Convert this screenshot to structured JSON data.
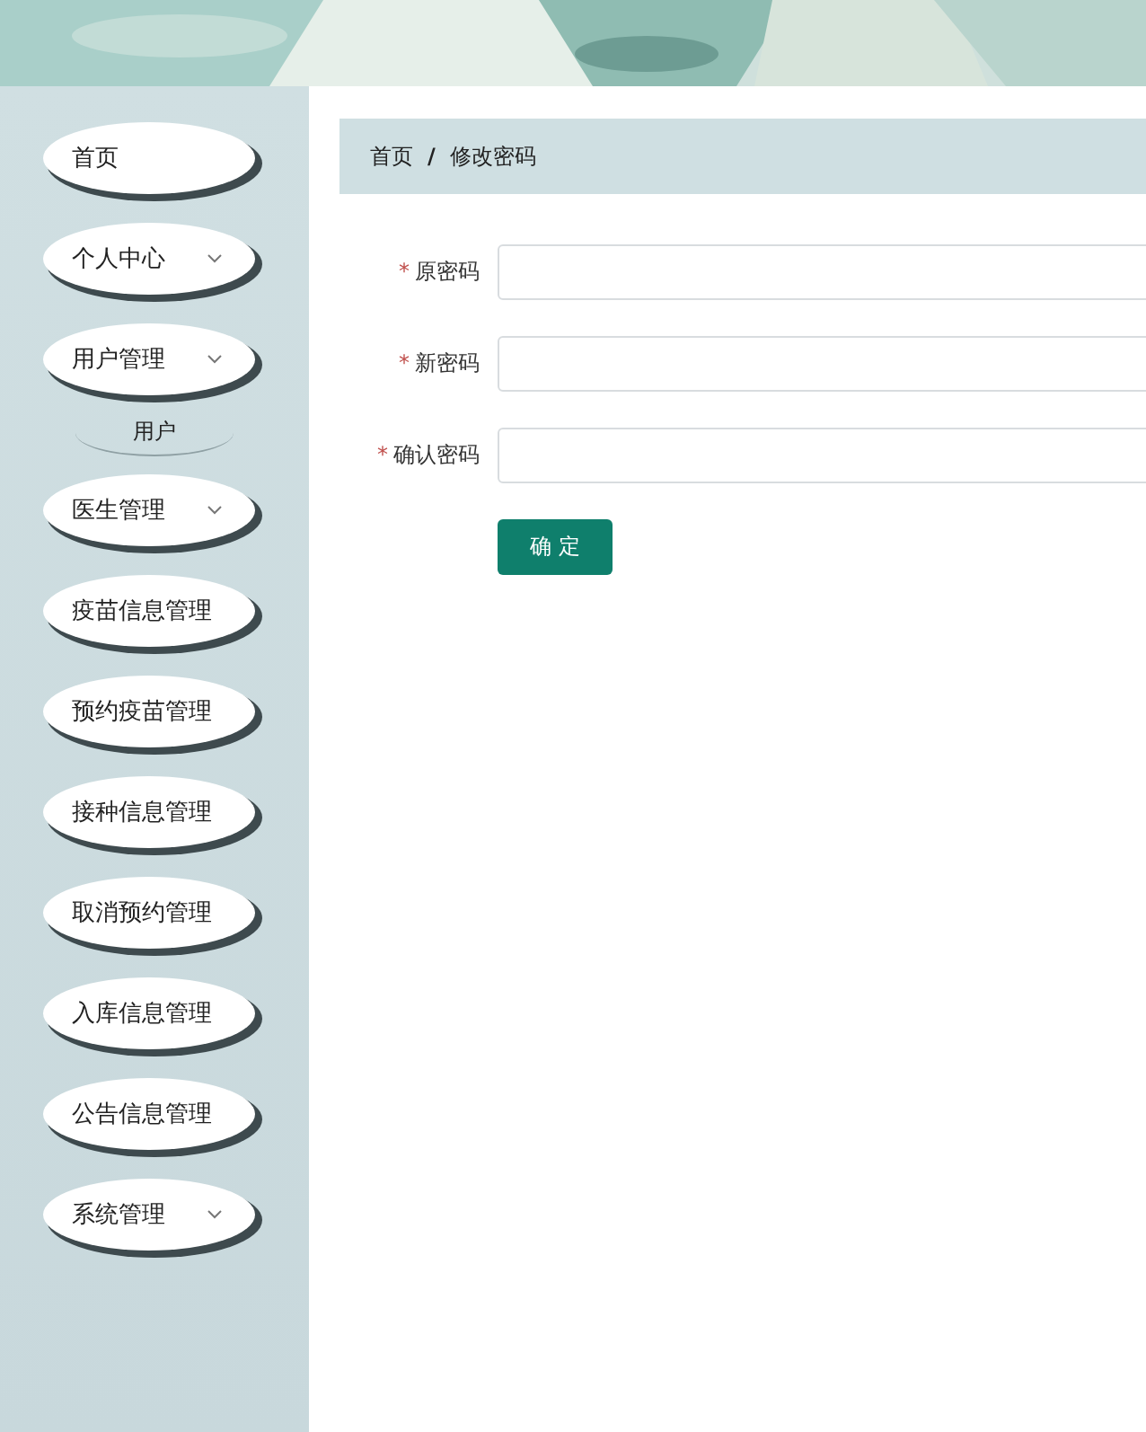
{
  "sidebar": {
    "items": [
      {
        "label": "首页",
        "kind": "link"
      },
      {
        "label": "个人中心",
        "kind": "menu"
      },
      {
        "label": "用户管理",
        "kind": "menu",
        "children": [
          {
            "label": "用户"
          }
        ]
      },
      {
        "label": "医生管理",
        "kind": "menu"
      },
      {
        "label": "疫苗信息管理",
        "kind": "link"
      },
      {
        "label": "预约疫苗管理",
        "kind": "link"
      },
      {
        "label": "接种信息管理",
        "kind": "link"
      },
      {
        "label": "取消预约管理",
        "kind": "link"
      },
      {
        "label": "入库信息管理",
        "kind": "link"
      },
      {
        "label": "公告信息管理",
        "kind": "link"
      },
      {
        "label": "系统管理",
        "kind": "menu"
      }
    ]
  },
  "breadcrumb": {
    "items": [
      "首页",
      "修改密码"
    ],
    "separator": "/"
  },
  "form": {
    "fields": [
      {
        "label": "原密码",
        "required": true,
        "mark": "*"
      },
      {
        "label": "新密码",
        "required": true,
        "mark": "*"
      },
      {
        "label": "确认密码",
        "required": true,
        "mark": "*"
      }
    ],
    "submit": "确 定"
  }
}
